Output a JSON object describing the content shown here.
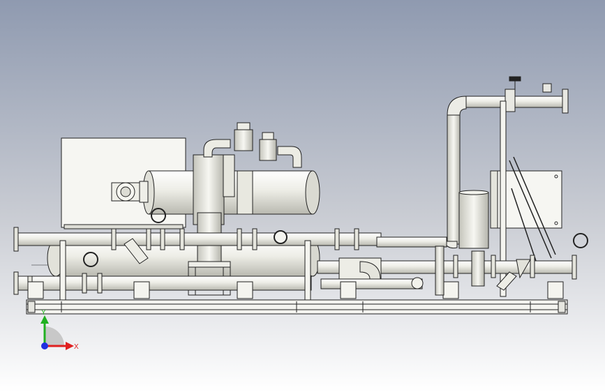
{
  "viewport": {
    "background_top": "#8f9ab0",
    "background_bottom": "#ffffff"
  },
  "model": {
    "part_fill": "#f2f2ec",
    "part_shade": "#cfcfc6",
    "edge_color": "#222222",
    "valve_handle_color": "#333333"
  },
  "triad": {
    "x_label": "X",
    "y_label": "Y",
    "x_color": "#e02020",
    "y_color": "#20b020",
    "z_color": "#2030e0"
  }
}
